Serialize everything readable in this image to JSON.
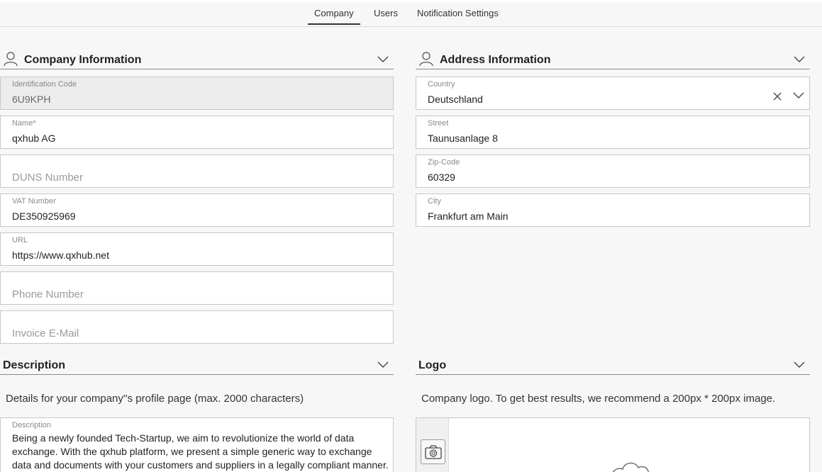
{
  "tabs": [
    {
      "label": "Company",
      "active": true
    },
    {
      "label": "Users",
      "active": false
    },
    {
      "label": "Notification Settings",
      "active": false
    }
  ],
  "company_info": {
    "title": "Company Information",
    "fields": {
      "identification_code": {
        "label": "Identification Code",
        "value": "6U9KPH"
      },
      "name": {
        "label": "Name*",
        "value": "qxhub AG"
      },
      "duns": {
        "placeholder": "DUNS Number"
      },
      "vat": {
        "label": "VAT Number",
        "value": "DE350925969"
      },
      "url": {
        "label": "URL",
        "value": "https://www.qxhub.net"
      },
      "phone": {
        "placeholder": "Phone Number"
      },
      "invoice_email": {
        "placeholder": "Invoice E-Mail"
      }
    }
  },
  "address_info": {
    "title": "Address Information",
    "fields": {
      "country": {
        "label": "Country",
        "value": "Deutschland"
      },
      "street": {
        "label": "Street",
        "value": "Taunusanlage 8"
      },
      "zip": {
        "label": "Zip-Code",
        "value": "60329"
      },
      "city": {
        "label": "City",
        "value": "Frankfurt am Main"
      }
    }
  },
  "description": {
    "title": "Description",
    "help": "Details for your company''s profile page (max. 2000 characters)",
    "field_label": "Description",
    "text": "Being a newly founded Tech-Startup, we aim to revolutionize the world of data exchange. With the qxhub platform, we present a simple generic way to exchange data and documents with your customers and suppliers in a legally compliant manner."
  },
  "logo": {
    "title": "Logo",
    "help": "Company logo. To get best results, we recommend a 200px * 200px image."
  }
}
